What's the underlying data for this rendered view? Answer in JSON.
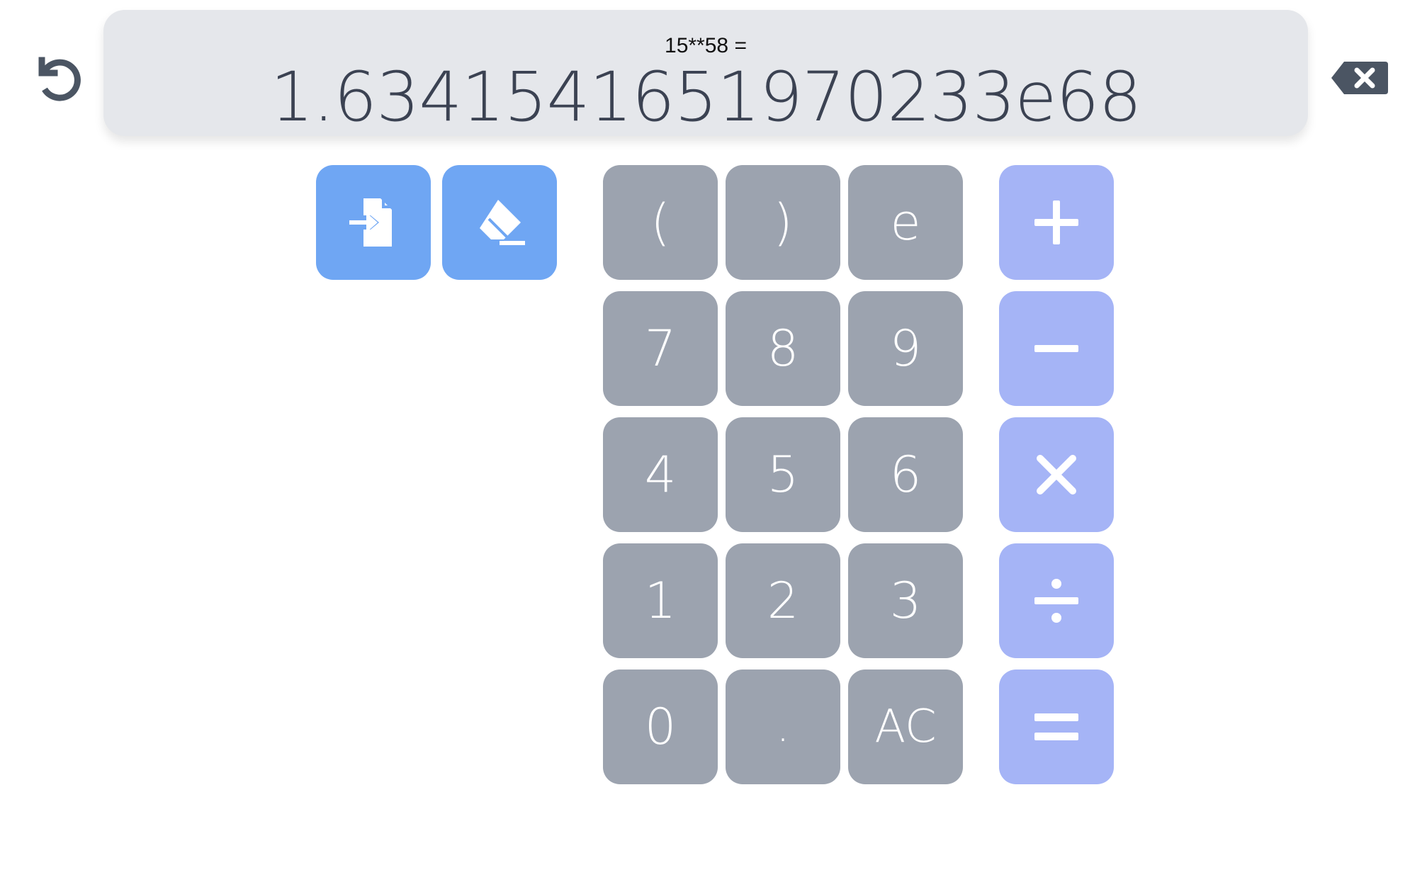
{
  "display": {
    "expression": "15**58 =",
    "result": "1.6341541651970233e68"
  },
  "toolbar": {
    "history_icon": "history-undo-icon",
    "backspace_icon": "backspace-icon",
    "insert_icon": "file-import-icon",
    "clear_icon": "eraser-icon"
  },
  "keypad": {
    "row1": [
      "(",
      ")",
      "e"
    ],
    "row2": [
      "7",
      "8",
      "9"
    ],
    "row3": [
      "4",
      "5",
      "6"
    ],
    "row4": [
      "1",
      "2",
      "3"
    ],
    "row5": [
      "0",
      ".",
      "AC"
    ]
  },
  "operators": {
    "add_icon": "plus-icon",
    "subtract_icon": "minus-icon",
    "multiply_icon": "times-icon",
    "divide_icon": "divide-icon",
    "equals_icon": "equals-icon"
  },
  "colors": {
    "display_bg": "#e5e7eb",
    "digit_key": "#9ca3af",
    "operator_key": "#a5b4f6",
    "tool_key": "#6fa6f3",
    "icon_dark": "#4b5563"
  }
}
